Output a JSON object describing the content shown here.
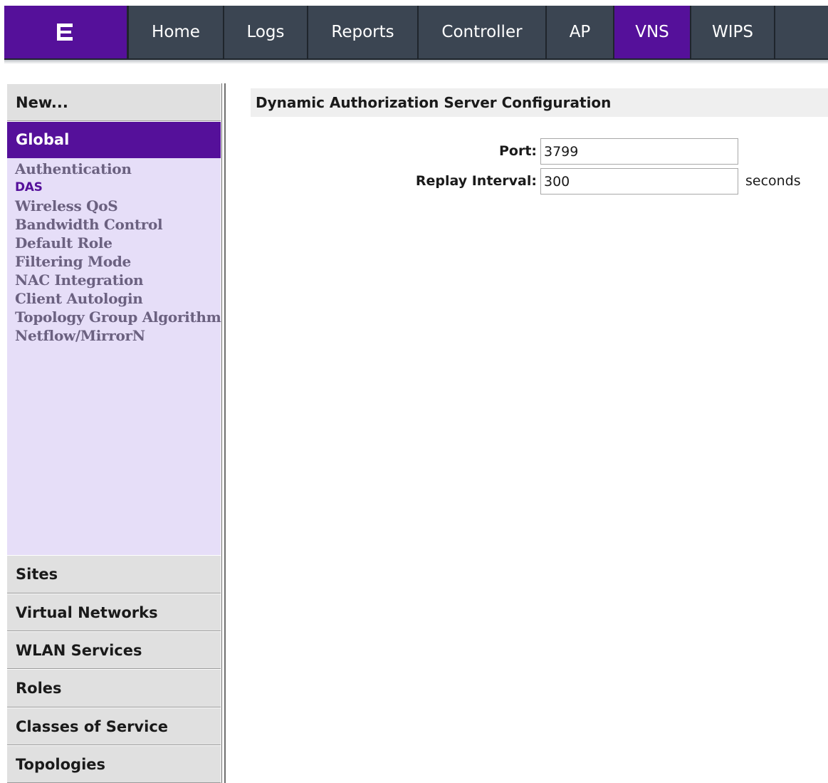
{
  "nav": {
    "logo_icon": "extreme-networks-logo-icon",
    "tabs": [
      {
        "label": "Home",
        "active": false
      },
      {
        "label": "Logs",
        "active": false
      },
      {
        "label": "Reports",
        "active": false
      },
      {
        "label": "Controller",
        "active": false
      },
      {
        "label": "AP",
        "active": false
      },
      {
        "label": "VNS",
        "active": true
      },
      {
        "label": "WIPS",
        "active": false
      }
    ]
  },
  "sidebar": {
    "new_label": "New...",
    "global_label": "Global",
    "global_items": [
      {
        "label": "Authentication",
        "active": false
      },
      {
        "label": "DAS",
        "active": true
      },
      {
        "label": "Wireless QoS",
        "active": false
      },
      {
        "label": "Bandwidth Control",
        "active": false
      },
      {
        "label": "Default Role",
        "active": false
      },
      {
        "label": "Filtering Mode",
        "active": false
      },
      {
        "label": "NAC Integration",
        "active": false
      },
      {
        "label": "Client Autologin",
        "active": false
      },
      {
        "label": "Topology Group Algorithm",
        "active": false
      },
      {
        "label": "Netflow/MirrorN",
        "active": false
      }
    ],
    "sections": [
      {
        "label": "Sites"
      },
      {
        "label": "Virtual Networks"
      },
      {
        "label": "WLAN Services"
      },
      {
        "label": "Roles"
      },
      {
        "label": "Classes of Service"
      },
      {
        "label": "Topologies"
      }
    ]
  },
  "main": {
    "title": "Dynamic Authorization Server Configuration",
    "port_label": "Port:",
    "port_value": "3799",
    "replay_label": "Replay Interval:",
    "replay_value": "300",
    "replay_unit": "seconds"
  },
  "colors": {
    "brand_purple": "#55109a",
    "nav_background": "#3b4552",
    "sidebar_background": "#e6def8"
  }
}
